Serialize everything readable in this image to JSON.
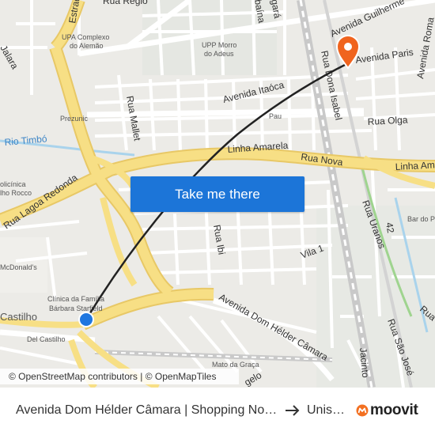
{
  "map": {
    "streets": {
      "avenida_guilherme": "Avenida Guilherme",
      "avenida_paris": "Avenida Paris",
      "avenida_roma": "Avenida Roma",
      "avenida_itaoca": "Avenida Itaóca",
      "rua_olga": "Rua Olga",
      "rua_dona_isabel": "Rua Dona Isabel",
      "linha_amarela_1": "Linha Amarela",
      "linha_amarela_2": "Linha Amar",
      "rua_nova": "Rua Nova",
      "rua_uranos": "Rua Uranos",
      "rua_mallet": "Rua Mallet",
      "rua_ibi": "Rua Ibi",
      "vila_1": "Vila 1",
      "rua_lagoa_redonda": "Rua Lagoa Redonda",
      "av_dom_helder": "Avenida Dom Hélder Câmara",
      "rua_sao_jose": "Rua São José",
      "rua_jacinto": "Jacinto",
      "rio_timbo": "Rio Timbó",
      "rua_regio": "Rua Régio",
      "estrada": "Estrad",
      "jalara": "Jalara",
      "rua_42": "42",
      "rua_ru": "Rua",
      "gelo": "gelo",
      "baina": "baína",
      "gara": "gará"
    },
    "pois": {
      "upa_line1": "UPA Complexo",
      "upa_line2": "do Alemão",
      "upp_line1": "UPP Morro",
      "upp_line2": "do Adeus",
      "prezunic": "Prezunic",
      "clinica_line1": "Clínica da Família",
      "clinica_line2": "Bárbara Starfield",
      "mcdonalds": "McDonald's",
      "del_castilho": "Del Castilho",
      "castilho": "Castilho",
      "bar_do_pe": "Bar do Pe",
      "policlinica": "olicínica",
      "rocco": "lho Rocco",
      "mato_graca": "Mato da Graça",
      "pau": "Pau"
    },
    "cta_label": "Take me there",
    "attribution": "© OpenStreetMap contributors | © OpenMapTiles"
  },
  "footer": {
    "from": "Avenida Dom Hélder Câmara | Shopping Nova América",
    "to": "Unisuam",
    "brand": "moovit"
  },
  "colors": {
    "highway": "#f7df85",
    "highway_outline": "#e8c866",
    "road": "#ffffff",
    "water": "#a9d3ec",
    "route": "#222222",
    "origin": "#1f77e0",
    "destination": "#f0641e",
    "cta": "#1c75d8",
    "brand_orange": "#f37021"
  }
}
